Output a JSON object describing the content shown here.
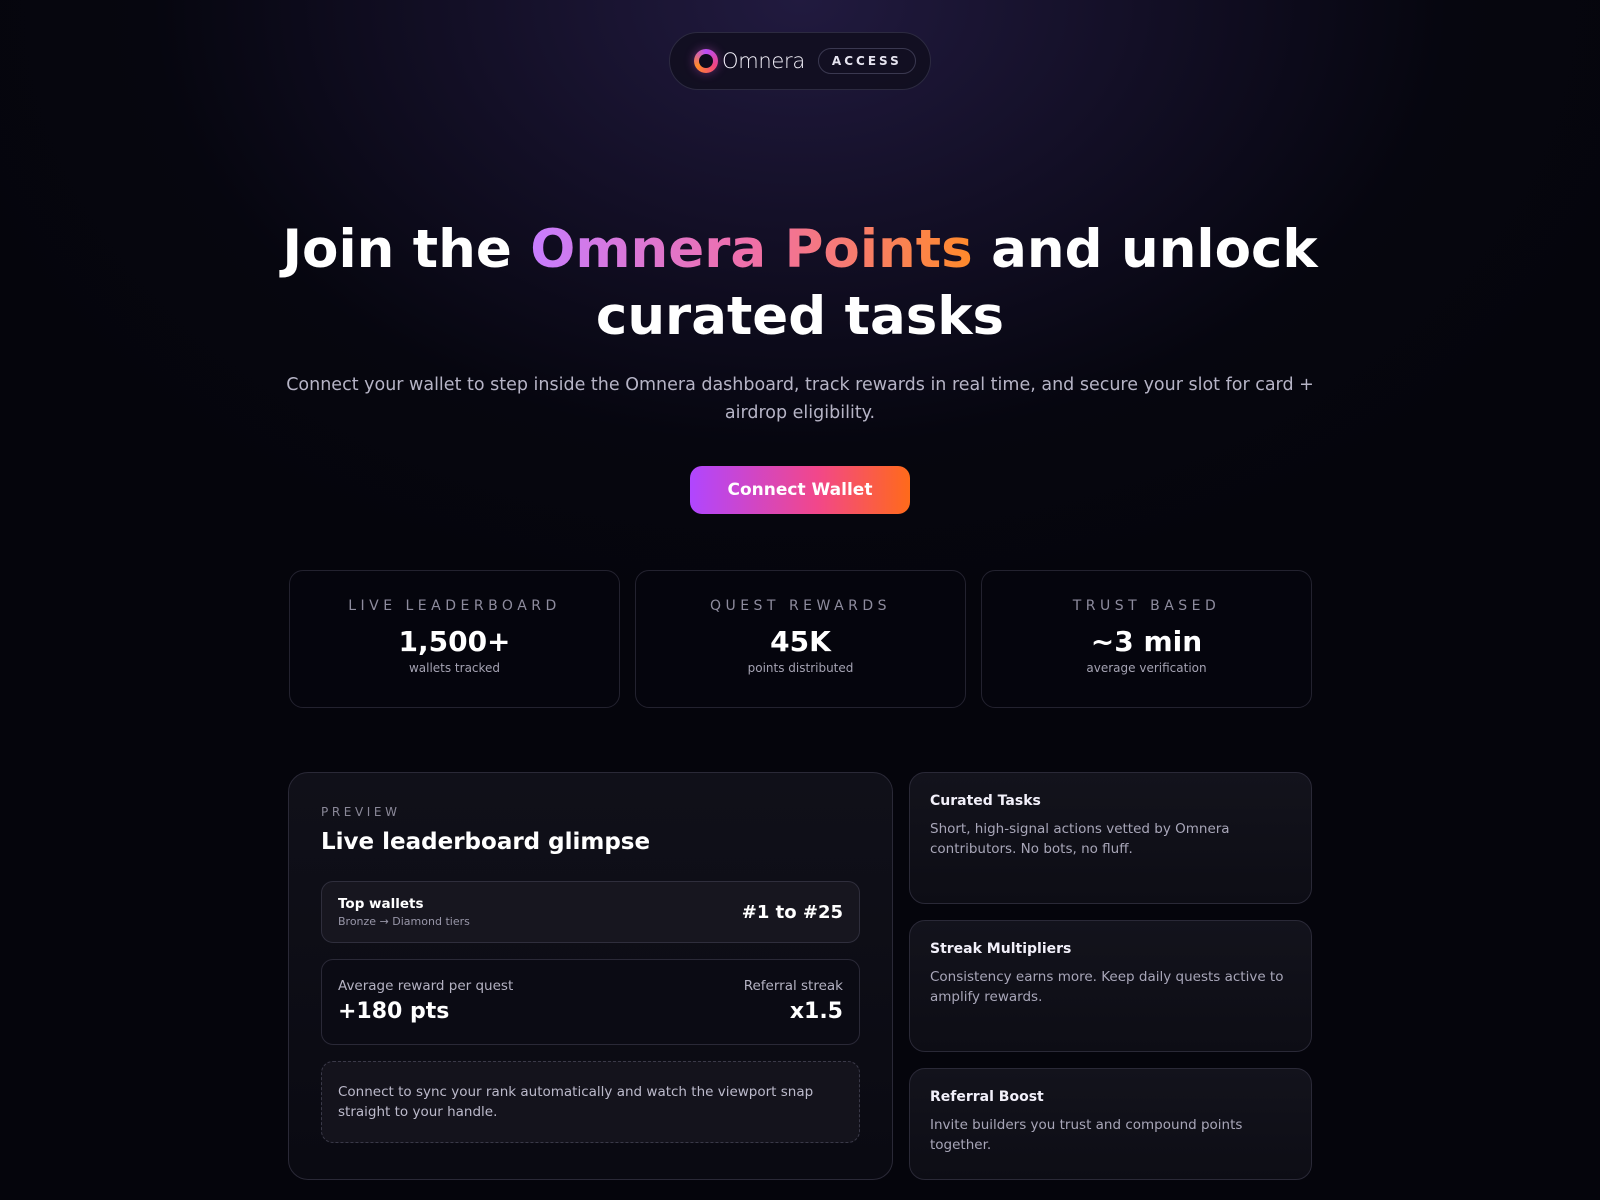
{
  "header": {
    "brand_name": "Omnera",
    "badge": "ACCESS",
    "logo_icon": "omnera-ring-logo"
  },
  "hero": {
    "title_before": "Join the ",
    "title_highlight": "Omnera Points",
    "title_after": " and unlock curated tasks",
    "subtitle": "Connect your wallet to step inside the Omnera dashboard, track rewards in real time, and secure your slot for card + airdrop eligibility.",
    "cta_label": "Connect Wallet"
  },
  "stats": [
    {
      "label": "LIVE LEADERBOARD",
      "value": "1,500+",
      "caption": "wallets tracked"
    },
    {
      "label": "QUEST REWARDS",
      "value": "45K",
      "caption": "points distributed"
    },
    {
      "label": "TRUST BASED",
      "value": "~3 min",
      "caption": "average verification"
    }
  ],
  "preview": {
    "kicker": "PREVIEW",
    "title": "Live leaderboard glimpse",
    "top_wallets": {
      "title": "Top wallets",
      "subtitle": "Bronze → Diamond tiers",
      "value": "#1 to #25"
    },
    "avg_reward": {
      "label": "Average reward per quest",
      "value": "+180 pts"
    },
    "referral": {
      "label": "Referral streak",
      "value": "x1.5"
    },
    "note": "Connect to sync your rank automatically and watch the viewport snap straight to your handle."
  },
  "features": [
    {
      "title": "Curated Tasks",
      "description": "Short, high-signal actions vetted by Omnera contributors. No bots, no fluff."
    },
    {
      "title": "Streak Multipliers",
      "description": "Consistency earns more. Keep daily quests active to amplify rewards."
    },
    {
      "title": "Referral Boost",
      "description": "Invite builders you trust and compound points together."
    }
  ],
  "colors": {
    "accent_purple": "#b046ff",
    "accent_pink": "#f2478a",
    "accent_orange": "#ff6a1a",
    "background": "#06060f"
  }
}
